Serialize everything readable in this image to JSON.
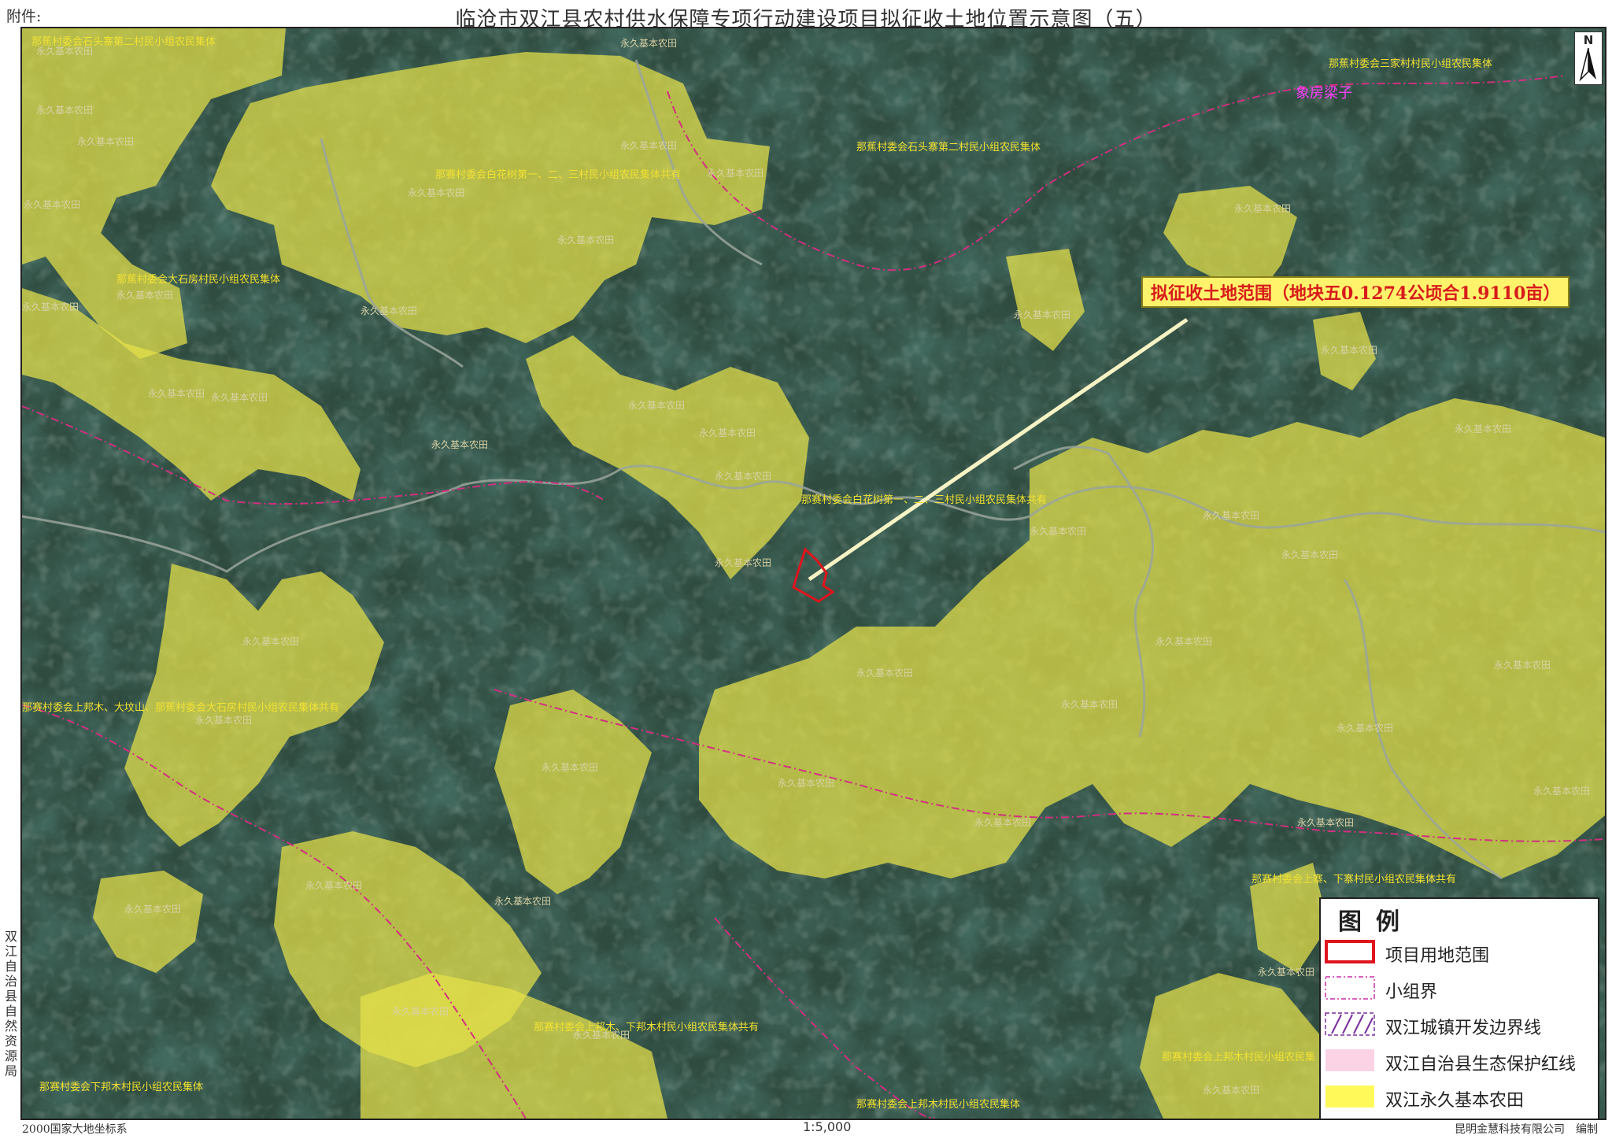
{
  "header": {
    "attachment": "附件:",
    "title": "临沧市双江县农村供水保障专项行动建设项目拟征收土地位置示意图（五）"
  },
  "map": {
    "north_label": "N",
    "callout": "拟征收土地范围（地块五0.1274公顷合1.9110亩）",
    "farmland_label": "永久基本农田",
    "village_labels": [
      "那蕉村委会石头寨第二村民小组农民集体",
      "那赛村委会白花树第一、二、三村民小组农民集体共有",
      "那蕉村委会大石房村民小组农民集体",
      "那蕉村委会三家村村民小组农民集体",
      "那蕉村委会石头寨第二村民小组农民集体",
      "那赛村委会白花树第一、二、三村民小组农民集体共有",
      "那赛村委会上邦木、大坟山、那蕉村委会大石房村民小组农民集体共有",
      "那赛村委会上寨、下寨村民小组农民集体共有",
      "那赛村委会上邦木、下邦木村民小组农民集体共有",
      "那赛村委会下邦木村民小组农民集体",
      "那赛村委会上邦木村民小组农民集体",
      "那赛村委会上邦木村民小组农民集"
    ],
    "place_name": "象房梁子"
  },
  "legend": {
    "title": "图例",
    "items": [
      {
        "label": "项目用地范围",
        "color": "#e0141e"
      },
      {
        "label": "小组界",
        "color": "#cc2fa8"
      },
      {
        "label": "双江城镇开发边界线",
        "color": "#7a2f9a"
      },
      {
        "label": "双江自治县生态保护红线",
        "color": "#fbd3e5"
      },
      {
        "label": "双江永久基本农田",
        "color": "#fff95a"
      }
    ]
  },
  "sidebar": {
    "agency": "双江自治县自然资源局"
  },
  "footer": {
    "crs": "2000国家大地坐标系",
    "scale": "1:5,000",
    "maker": "昆明金慧科技有限公司　编制"
  }
}
